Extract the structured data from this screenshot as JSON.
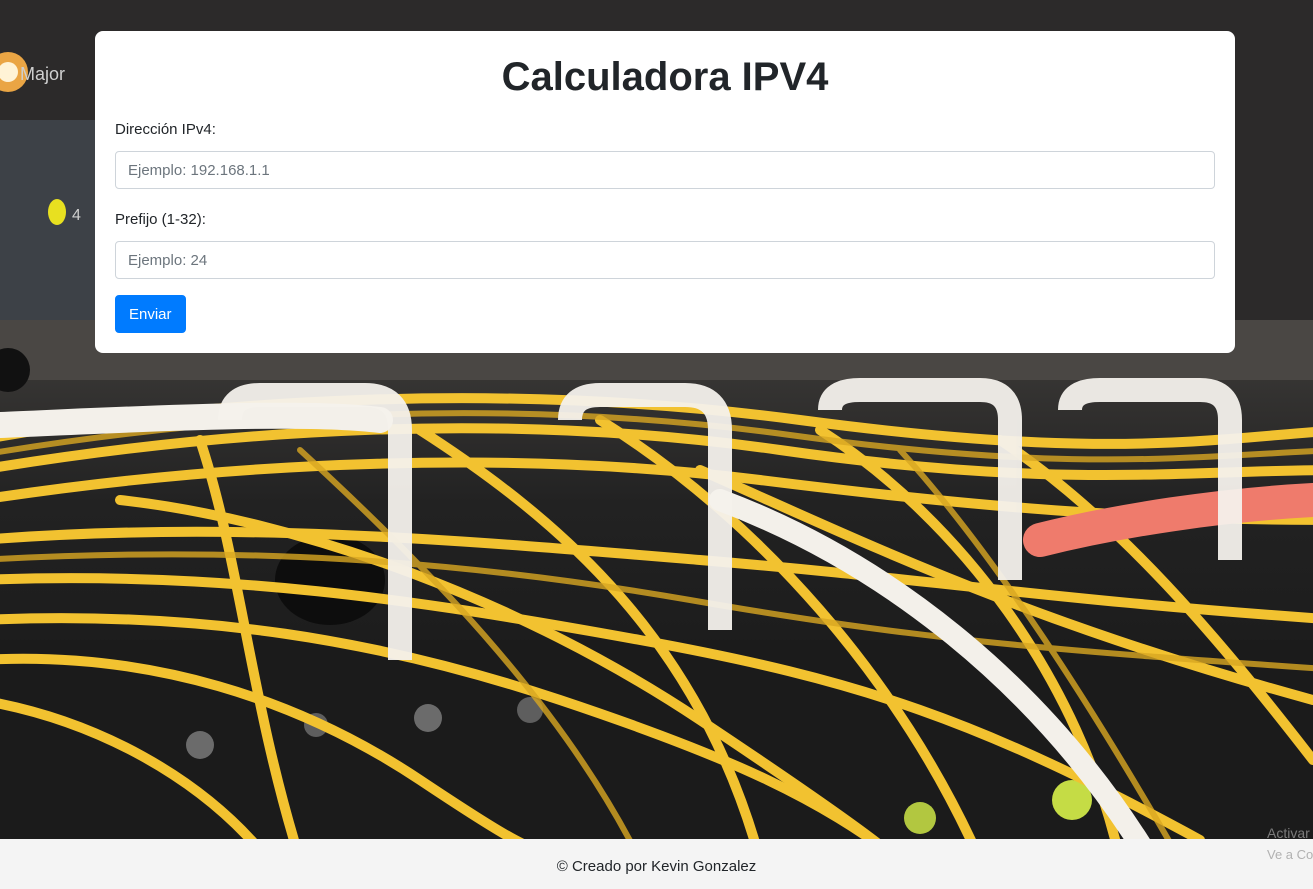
{
  "app": {
    "title": "Calculadora IPV4"
  },
  "form": {
    "ip": {
      "label": "Dirección IPv4:",
      "value": "",
      "placeholder": "Ejemplo: 192.168.1.1"
    },
    "prefix": {
      "label": "Prefijo (1-32):",
      "value": "",
      "placeholder": "Ejemplo: 24"
    },
    "submit_label": "Enviar"
  },
  "footer": {
    "text": "© Creado por Kevin Gonzalez"
  },
  "background": {
    "device_label": "Major",
    "port_number": "4"
  },
  "watermark": {
    "line1": "Activar Windows",
    "line2": "Ve a Configuración"
  },
  "colors": {
    "accent": "#007bff",
    "card_bg": "#ffffff",
    "footer_bg": "#f4f4f4",
    "cable": "#f2c230"
  }
}
